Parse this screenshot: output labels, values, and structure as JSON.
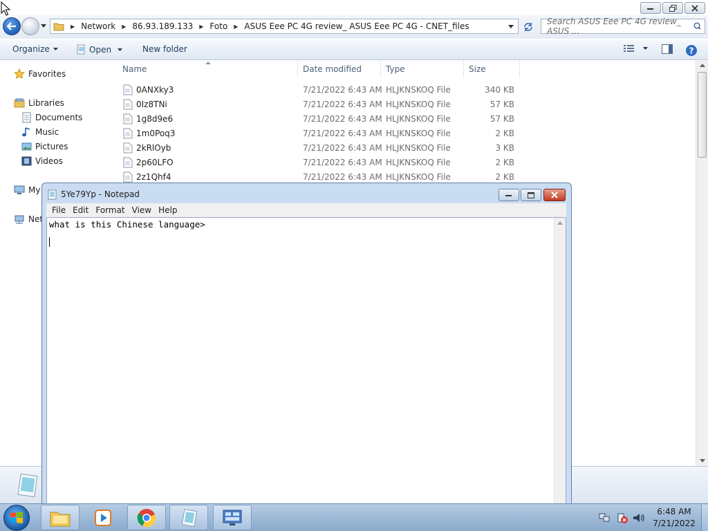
{
  "window": {
    "minimize_label": "Minimize",
    "maximize_label": "Maximize",
    "close_label": "Close"
  },
  "address_bar": {
    "crumbs": [
      "Network",
      "86.93.189.133",
      "Foto",
      "ASUS Eee PC 4G review_ ASUS Eee PC 4G - CNET_files"
    ]
  },
  "search": {
    "placeholder": "Search ASUS Eee PC 4G review_ ASUS ..."
  },
  "toolbar": {
    "organize": "Organize",
    "open": "Open",
    "new_folder": "New folder"
  },
  "nav": {
    "favorites": "Favorites",
    "libraries": "Libraries",
    "documents": "Documents",
    "music": "Music",
    "pictures": "Pictures",
    "videos": "Videos",
    "my": "My",
    "network": "Net"
  },
  "columns": {
    "name": "Name",
    "date_modified": "Date modified",
    "type": "Type",
    "size": "Size"
  },
  "files": [
    {
      "name": "0ANXky3",
      "date": "7/21/2022 6:43 AM",
      "type": "HLJKNSKOQ File",
      "size": "340 KB"
    },
    {
      "name": "0Iz8TNi",
      "date": "7/21/2022 6:43 AM",
      "type": "HLJKNSKOQ File",
      "size": "57 KB"
    },
    {
      "name": "1g8d9e6",
      "date": "7/21/2022 6:43 AM",
      "type": "HLJKNSKOQ File",
      "size": "57 KB"
    },
    {
      "name": "1m0Poq3",
      "date": "7/21/2022 6:43 AM",
      "type": "HLJKNSKOQ File",
      "size": "2 KB"
    },
    {
      "name": "2kRlOyb",
      "date": "7/21/2022 6:43 AM",
      "type": "HLJKNSKOQ File",
      "size": "3 KB"
    },
    {
      "name": "2p60LFO",
      "date": "7/21/2022 6:43 AM",
      "type": "HLJKNSKOQ File",
      "size": "2 KB"
    },
    {
      "name": "2z1Qhf4",
      "date": "7/21/2022 6:43 AM",
      "type": "HLJKNSKOQ File",
      "size": "2 KB"
    }
  ],
  "notepad": {
    "title": "5Ye79Yp - Notepad",
    "menu": [
      "File",
      "Edit",
      "Format",
      "View",
      "Help"
    ],
    "content": "what is this Chinese language>"
  },
  "taskbar": {
    "time": "6:48 AM",
    "date": "7/21/2022",
    "apps": [
      "explorer-icon",
      "media-player-icon",
      "chrome-icon",
      "notepad-icon",
      "control-panel-icon"
    ]
  },
  "colors": {
    "accent": "#1f5fb8",
    "window_frame": "#c9dcf2",
    "taskbar": "#a3bedd",
    "close_red": "#c94a3a"
  }
}
